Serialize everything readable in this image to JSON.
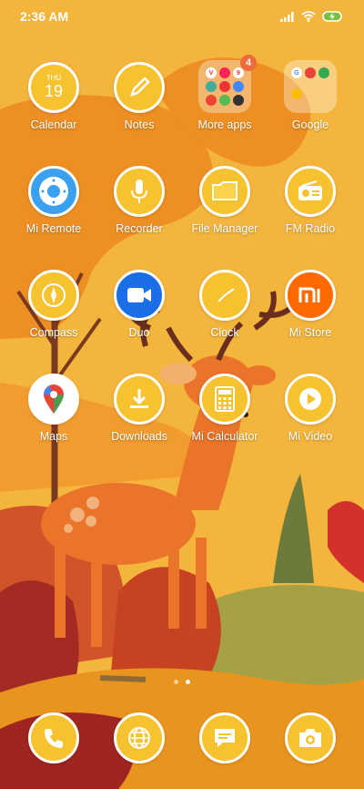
{
  "status_bar": {
    "time": "2:36 AM",
    "icons": [
      "signal-icon",
      "wifi-icon",
      "battery-charging-icon"
    ]
  },
  "calendar": {
    "weekday": "THU",
    "day": "19"
  },
  "more_apps_badge": "4",
  "apps": [
    {
      "label": "Calendar"
    },
    {
      "label": "Notes"
    },
    {
      "label": "More apps"
    },
    {
      "label": "Google"
    },
    {
      "label": "Mi Remote"
    },
    {
      "label": "Recorder"
    },
    {
      "label": "File Manager"
    },
    {
      "label": "FM Radio"
    },
    {
      "label": "Compass"
    },
    {
      "label": "Duo"
    },
    {
      "label": "Clock"
    },
    {
      "label": "Mi Store"
    },
    {
      "label": "Maps"
    },
    {
      "label": "Downloads"
    },
    {
      "label": "Mi Calculator"
    },
    {
      "label": "Mi Video"
    }
  ],
  "page_indicator": {
    "pages": 2,
    "active": 2
  },
  "dock": [
    "Phone",
    "Browser",
    "Messaging",
    "Camera"
  ],
  "colors": {
    "wallpaper_base": "#f4b53c",
    "icon_yellow": "#f7c230",
    "duo_blue": "#1a6ee8",
    "mi_orange": "#ff6a00",
    "badge": "#ee6a3a"
  }
}
